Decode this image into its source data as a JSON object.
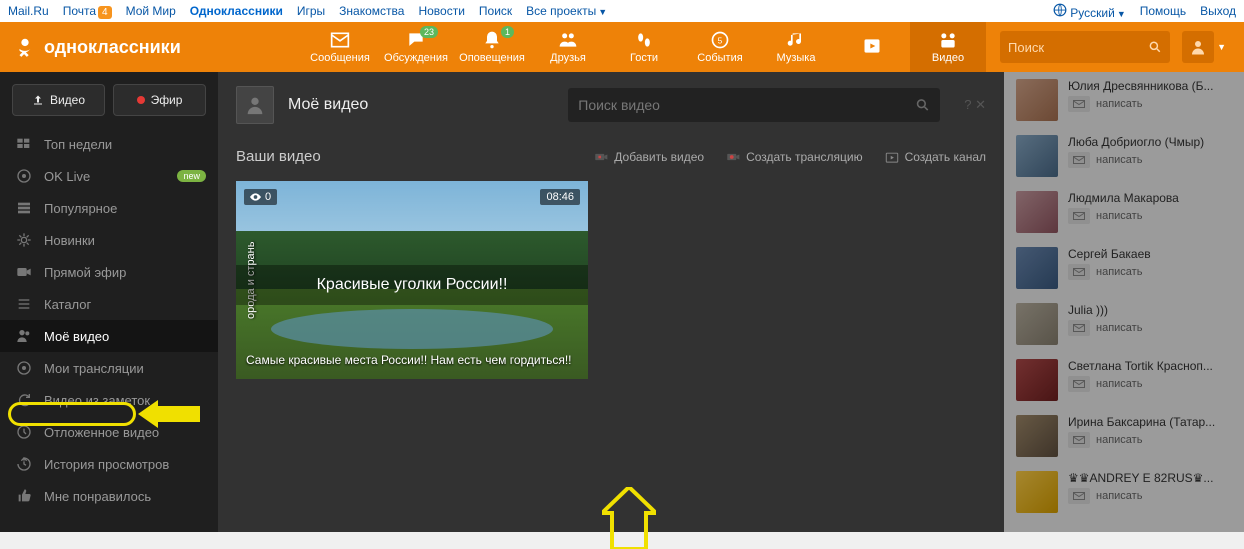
{
  "topbar": {
    "left": [
      {
        "label": "Mail.Ru"
      },
      {
        "label": "Почта",
        "badge": "4"
      },
      {
        "label": "Мой Мир"
      },
      {
        "label": "Одноклассники",
        "active": true
      },
      {
        "label": "Игры"
      },
      {
        "label": "Знакомства"
      },
      {
        "label": "Новости"
      },
      {
        "label": "Поиск"
      },
      {
        "label": "Все проекты",
        "caret": true
      }
    ],
    "right": [
      {
        "label": "Русский",
        "globe": true,
        "caret": true
      },
      {
        "label": "Помощь"
      },
      {
        "label": "Выход"
      }
    ]
  },
  "header": {
    "brand": "одноклассники",
    "nav": [
      {
        "label": "Сообщения",
        "icon": "mail"
      },
      {
        "label": "Обсуждения",
        "icon": "chat",
        "badge": "23"
      },
      {
        "label": "Оповещения",
        "icon": "bell",
        "badge": "1"
      },
      {
        "label": "Друзья",
        "icon": "friends"
      },
      {
        "label": "Гости",
        "icon": "feet"
      },
      {
        "label": "События",
        "icon": "star"
      },
      {
        "label": "Музыка",
        "icon": "music"
      },
      {
        "label": "",
        "icon": "play"
      },
      {
        "label": "Видео",
        "icon": "video",
        "active": true
      }
    ],
    "search_placeholder": "Поиск"
  },
  "video_sidebar": {
    "upload_btn": "Видео",
    "live_btn": "Эфир",
    "items": [
      {
        "label": "Топ недели",
        "icon": "grid"
      },
      {
        "label": "OK Live",
        "icon": "target",
        "pill": "new"
      },
      {
        "label": "Популярное",
        "icon": "stack"
      },
      {
        "label": "Новинки",
        "icon": "gear"
      },
      {
        "label": "Прямой эфир",
        "icon": "cam"
      },
      {
        "label": "Каталог",
        "icon": "list"
      },
      {
        "label": "Моё видео",
        "icon": "user",
        "active": true
      },
      {
        "label": "Мои трансляции",
        "icon": "target"
      },
      {
        "label": "Видео из заметок",
        "icon": "redo"
      },
      {
        "label": "Отложенное видео",
        "icon": "clock"
      },
      {
        "label": "История просмотров",
        "icon": "history"
      },
      {
        "label": "Мне понравилось",
        "icon": "thumb"
      }
    ]
  },
  "video_content": {
    "title": "Моё видео",
    "search_placeholder": "Поиск видео",
    "help": "? ✕",
    "subtitle": "Ваши видео",
    "actions": [
      {
        "label": "Добавить видео",
        "icon": "add"
      },
      {
        "label": "Создать трансляцию",
        "icon": "live"
      },
      {
        "label": "Создать канал",
        "icon": "channel"
      }
    ],
    "card": {
      "views": "0",
      "duration": "08:46",
      "side_caption": "орода и странь",
      "banner": "Красивые уголки России!!",
      "title": "Самые красивые места России!! Нам есть чем гордиться!!"
    }
  },
  "friends": [
    {
      "name": "Юлия Дресвянникова (Б...",
      "c": "c1"
    },
    {
      "name": "Люба Добриогло (Чмыр)",
      "c": "c2"
    },
    {
      "name": "Людмила Макарова",
      "c": "c3"
    },
    {
      "name": "Сергей Бакаев",
      "c": "c4"
    },
    {
      "name": "Julia )))",
      "c": "c5"
    },
    {
      "name": "Светлана Tortik Красноп...",
      "c": "c6"
    },
    {
      "name": "Ирина Баксарина (Татар...",
      "c": "c7"
    },
    {
      "name": "♛♛ANDREY Е 82RUS♛...",
      "c": "c8"
    }
  ],
  "write_label": "написать"
}
